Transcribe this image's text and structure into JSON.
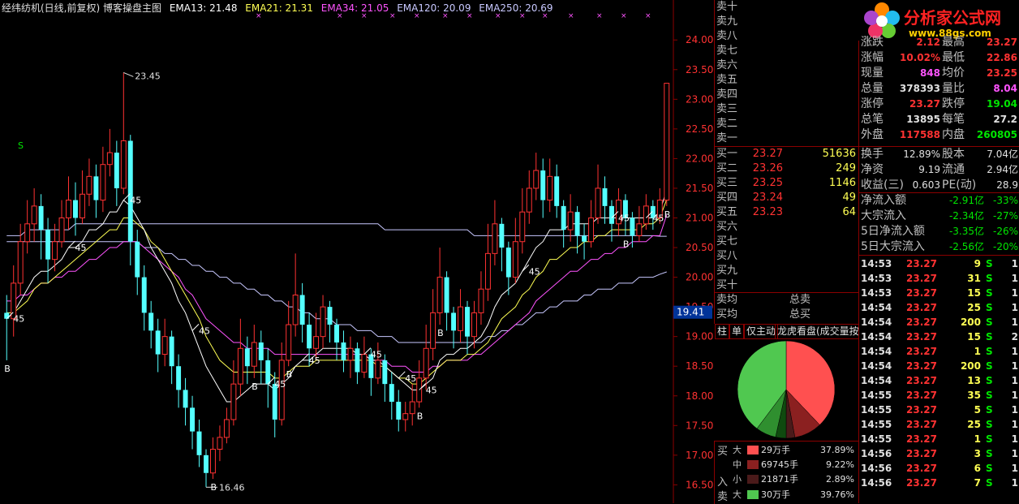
{
  "header": {
    "title": "经纬纺机(日线,前复权) 博客操盘主图",
    "ema13": "EMA13: 21.48",
    "ema21": "EMA21: 21.31",
    "ema34": "EMA34: 21.05",
    "ema120": "EMA120: 20.09",
    "ema250": "EMA250: 20.69"
  },
  "colors": {
    "up": "#ff3232",
    "down": "#54ffff",
    "ema13": "#ffffff",
    "ema21": "#ffff54",
    "ema34": "#ff54ff",
    "ema120": "#c8c8ff",
    "ema250": "#c8c8ff"
  },
  "price_axis": [
    "24.00",
    "23.50",
    "23.00",
    "22.50",
    "22.00",
    "21.50",
    "21.00",
    "20.50",
    "20.00",
    "19.50",
    "19.00",
    "18.50",
    "18.00",
    "17.50",
    "17.00",
    "16.50"
  ],
  "price_axis_current": "19.41",
  "annotations": {
    "high": "23.45",
    "low": "16.46",
    "mark45": "45",
    "b": "B",
    "s": "S"
  },
  "chart_data": {
    "type": "candlestick",
    "ylim": [
      16.3,
      24.4
    ],
    "candles": [
      [
        19.4,
        19.3,
        19.7,
        18.6
      ],
      [
        19.3,
        19.9,
        20.2,
        19.0
      ],
      [
        19.9,
        20.6,
        20.9,
        19.7
      ],
      [
        20.6,
        20.9,
        21.3,
        20.4
      ],
      [
        20.9,
        21.2,
        21.5,
        20.6
      ],
      [
        21.2,
        20.8,
        21.4,
        20.3
      ],
      [
        20.8,
        20.3,
        21.0,
        19.9
      ],
      [
        20.3,
        20.6,
        20.9,
        20.1
      ],
      [
        20.6,
        21.0,
        21.3,
        20.5
      ],
      [
        21.0,
        21.3,
        21.7,
        20.8
      ],
      [
        21.3,
        21.0,
        21.6,
        20.7
      ],
      [
        21.0,
        21.4,
        21.8,
        20.9
      ],
      [
        21.4,
        21.7,
        22.0,
        21.2
      ],
      [
        21.7,
        21.3,
        21.9,
        21.0
      ],
      [
        21.3,
        21.9,
        22.2,
        21.1
      ],
      [
        21.9,
        22.1,
        22.5,
        21.7
      ],
      [
        22.1,
        21.5,
        22.3,
        21.2
      ],
      [
        21.5,
        22.3,
        23.45,
        21.4
      ],
      [
        22.3,
        20.6,
        22.4,
        20.2
      ],
      [
        20.6,
        20.0,
        20.8,
        19.7
      ],
      [
        20.0,
        19.4,
        20.2,
        19.1
      ],
      [
        19.4,
        19.1,
        19.6,
        18.8
      ],
      [
        19.1,
        18.7,
        19.3,
        18.4
      ],
      [
        18.7,
        19.0,
        19.3,
        18.5
      ],
      [
        19.0,
        18.5,
        19.1,
        18.2
      ],
      [
        18.5,
        18.1,
        18.7,
        17.8
      ],
      [
        18.1,
        17.8,
        18.3,
        17.5
      ],
      [
        17.8,
        17.4,
        18.0,
        17.1
      ],
      [
        17.4,
        17.0,
        17.6,
        16.8
      ],
      [
        17.0,
        16.7,
        17.1,
        16.46
      ],
      [
        16.7,
        17.1,
        17.3,
        16.6
      ],
      [
        17.1,
        17.3,
        17.5,
        16.9
      ],
      [
        17.3,
        17.6,
        17.8,
        17.2
      ],
      [
        17.6,
        18.2,
        18.6,
        17.5
      ],
      [
        18.2,
        18.8,
        19.3,
        18.0
      ],
      [
        18.8,
        18.5,
        19.0,
        18.2
      ],
      [
        18.5,
        18.9,
        19.2,
        18.3
      ],
      [
        18.9,
        18.6,
        19.1,
        18.2
      ],
      [
        18.6,
        18.2,
        18.8,
        17.8
      ],
      [
        18.2,
        17.6,
        18.4,
        17.3
      ],
      [
        17.6,
        18.6,
        18.9,
        17.5
      ],
      [
        18.6,
        19.2,
        19.6,
        18.5
      ],
      [
        19.2,
        19.7,
        20.4,
        19.0
      ],
      [
        19.7,
        19.2,
        19.9,
        18.9
      ],
      [
        19.2,
        18.8,
        19.4,
        18.5
      ],
      [
        18.8,
        19.0,
        19.4,
        18.6
      ],
      [
        19.0,
        19.5,
        19.7,
        18.8
      ],
      [
        19.5,
        19.2,
        19.6,
        18.9
      ],
      [
        19.2,
        18.9,
        19.3,
        18.6
      ],
      [
        18.9,
        18.6,
        19.1,
        18.4
      ],
      [
        18.6,
        18.8,
        19.0,
        18.3
      ],
      [
        18.8,
        18.4,
        18.9,
        18.2
      ],
      [
        18.4,
        18.7,
        19.0,
        18.3
      ],
      [
        18.7,
        18.3,
        18.8,
        18.0
      ],
      [
        18.3,
        18.6,
        18.9,
        18.2
      ],
      [
        18.6,
        18.2,
        18.7,
        17.9
      ],
      [
        18.2,
        17.9,
        18.4,
        17.6
      ],
      [
        17.9,
        17.6,
        18.1,
        17.4
      ],
      [
        17.6,
        17.7,
        17.9,
        17.4
      ],
      [
        17.7,
        17.9,
        18.2,
        17.5
      ],
      [
        17.9,
        18.3,
        18.6,
        17.8
      ],
      [
        18.3,
        18.8,
        19.2,
        18.1
      ],
      [
        18.8,
        19.4,
        19.8,
        18.6
      ],
      [
        19.4,
        20.0,
        20.5,
        19.2
      ],
      [
        20.0,
        19.4,
        20.1,
        19.1
      ],
      [
        19.4,
        19.1,
        19.5,
        18.8
      ],
      [
        19.1,
        19.5,
        19.8,
        18.9
      ],
      [
        19.5,
        19.0,
        19.6,
        18.7
      ],
      [
        19.0,
        19.4,
        19.6,
        18.8
      ],
      [
        19.4,
        19.8,
        20.1,
        19.2
      ],
      [
        19.8,
        20.4,
        20.9,
        19.6
      ],
      [
        20.4,
        20.9,
        21.3,
        20.2
      ],
      [
        20.9,
        20.5,
        21.0,
        20.1
      ],
      [
        20.5,
        20.0,
        20.6,
        19.7
      ],
      [
        20.0,
        20.6,
        21.0,
        19.9
      ],
      [
        20.6,
        21.1,
        21.5,
        20.4
      ],
      [
        21.1,
        21.5,
        21.8,
        20.9
      ],
      [
        21.5,
        21.8,
        22.1,
        21.3
      ],
      [
        21.8,
        21.3,
        22.0,
        21.0
      ],
      [
        21.3,
        21.7,
        22.0,
        21.1
      ],
      [
        21.7,
        21.2,
        21.9,
        21.0
      ],
      [
        21.2,
        20.8,
        21.3,
        20.5
      ],
      [
        20.8,
        21.1,
        21.4,
        20.6
      ],
      [
        21.1,
        20.7,
        21.2,
        20.4
      ],
      [
        20.7,
        20.6,
        20.9,
        20.3
      ],
      [
        20.6,
        21.0,
        21.3,
        20.5
      ],
      [
        21.0,
        21.5,
        21.9,
        20.9
      ],
      [
        21.5,
        21.2,
        21.7,
        20.9
      ],
      [
        21.2,
        20.9,
        21.3,
        20.6
      ],
      [
        20.9,
        21.3,
        21.5,
        20.7
      ],
      [
        21.3,
        21.0,
        21.4,
        20.7
      ],
      [
        21.0,
        20.7,
        21.1,
        20.5
      ],
      [
        20.7,
        20.9,
        21.2,
        20.6
      ],
      [
        20.9,
        21.2,
        21.4,
        20.8
      ],
      [
        21.2,
        21.0,
        21.3,
        20.8
      ],
      [
        21.0,
        21.3,
        21.5,
        20.9
      ],
      [
        21.3,
        23.27,
        23.27,
        21.2
      ]
    ],
    "ema13": [
      19.3,
      19.4,
      19.6,
      19.8,
      20.0,
      20.1,
      20.1,
      20.2,
      20.3,
      20.5,
      20.5,
      20.6,
      20.8,
      20.8,
      20.9,
      21.1,
      21.1,
      21.3,
      21.2,
      21.0,
      20.8,
      20.5,
      20.3,
      20.1,
      19.9,
      19.6,
      19.4,
      19.1,
      18.8,
      18.5,
      18.3,
      18.1,
      17.9,
      17.9,
      18.0,
      18.1,
      18.2,
      18.2,
      18.2,
      18.1,
      18.2,
      18.3,
      18.5,
      18.6,
      18.6,
      18.7,
      18.8,
      18.8,
      18.8,
      18.8,
      18.8,
      18.7,
      18.7,
      18.6,
      18.6,
      18.5,
      18.4,
      18.3,
      18.2,
      18.1,
      18.1,
      18.2,
      18.3,
      18.6,
      18.7,
      18.7,
      18.8,
      18.8,
      18.9,
      19.0,
      19.2,
      19.5,
      19.7,
      19.8,
      19.9,
      20.1,
      20.3,
      20.5,
      20.6,
      20.8,
      20.8,
      20.8,
      20.9,
      20.9,
      20.9,
      20.9,
      21.0,
      21.0,
      21.0,
      21.0,
      21.0,
      21.0,
      21.0,
      21.0,
      21.0,
      21.1,
      21.48
    ],
    "ema21": [
      19.4,
      19.4,
      19.5,
      19.6,
      19.8,
      19.9,
      19.9,
      20.0,
      20.1,
      20.2,
      20.3,
      20.4,
      20.5,
      20.6,
      20.7,
      20.8,
      20.8,
      21.0,
      21.0,
      20.9,
      20.8,
      20.6,
      20.5,
      20.3,
      20.1,
      19.9,
      19.7,
      19.5,
      19.3,
      19.0,
      18.8,
      18.6,
      18.5,
      18.4,
      18.4,
      18.4,
      18.4,
      18.4,
      18.4,
      18.3,
      18.3,
      18.4,
      18.5,
      18.5,
      18.5,
      18.6,
      18.6,
      18.6,
      18.6,
      18.6,
      18.6,
      18.6,
      18.6,
      18.6,
      18.5,
      18.5,
      18.4,
      18.3,
      18.3,
      18.2,
      18.2,
      18.3,
      18.4,
      18.5,
      18.6,
      18.6,
      18.6,
      18.7,
      18.7,
      18.8,
      18.9,
      19.1,
      19.3,
      19.4,
      19.5,
      19.7,
      19.8,
      20.0,
      20.1,
      20.3,
      20.3,
      20.4,
      20.5,
      20.5,
      20.6,
      20.6,
      20.7,
      20.7,
      20.8,
      20.8,
      20.8,
      20.8,
      20.8,
      20.9,
      20.9,
      21.0,
      21.31
    ],
    "ema34": [
      19.6,
      19.6,
      19.7,
      19.7,
      19.8,
      19.9,
      19.9,
      20.0,
      20.0,
      20.1,
      20.1,
      20.2,
      20.3,
      20.3,
      20.4,
      20.5,
      20.5,
      20.6,
      20.6,
      20.6,
      20.5,
      20.4,
      20.3,
      20.2,
      20.1,
      20.0,
      19.8,
      19.7,
      19.5,
      19.3,
      19.2,
      19.1,
      19.0,
      18.9,
      18.9,
      18.8,
      18.8,
      18.8,
      18.8,
      18.7,
      18.7,
      18.7,
      18.7,
      18.7,
      18.7,
      18.7,
      18.7,
      18.7,
      18.7,
      18.7,
      18.7,
      18.7,
      18.7,
      18.6,
      18.6,
      18.6,
      18.5,
      18.5,
      18.5,
      18.4,
      18.4,
      18.4,
      18.5,
      18.5,
      18.6,
      18.6,
      18.6,
      18.6,
      18.7,
      18.7,
      18.8,
      18.9,
      19.0,
      19.1,
      19.2,
      19.3,
      19.4,
      19.6,
      19.7,
      19.8,
      19.9,
      20.0,
      20.1,
      20.1,
      20.2,
      20.3,
      20.3,
      20.4,
      20.4,
      20.5,
      20.5,
      20.6,
      20.6,
      20.6,
      20.7,
      20.7,
      21.05
    ],
    "ema120": [
      20.6,
      20.6,
      20.6,
      20.6,
      20.6,
      20.6,
      20.6,
      20.6,
      20.6,
      20.6,
      20.6,
      20.6,
      20.6,
      20.6,
      20.6,
      20.6,
      20.6,
      20.6,
      20.6,
      20.6,
      20.5,
      20.5,
      20.5,
      20.4,
      20.4,
      20.3,
      20.3,
      20.2,
      20.2,
      20.1,
      20.1,
      20.0,
      20.0,
      19.9,
      19.9,
      19.8,
      19.8,
      19.7,
      19.7,
      19.6,
      19.6,
      19.5,
      19.5,
      19.4,
      19.4,
      19.3,
      19.3,
      19.3,
      19.2,
      19.2,
      19.2,
      19.1,
      19.1,
      19.1,
      19.0,
      19.0,
      19.0,
      18.9,
      18.9,
      18.9,
      18.9,
      18.9,
      18.9,
      18.9,
      18.9,
      18.9,
      18.9,
      18.9,
      18.9,
      18.9,
      19.0,
      19.0,
      19.1,
      19.1,
      19.2,
      19.2,
      19.3,
      19.4,
      19.4,
      19.5,
      19.5,
      19.6,
      19.6,
      19.6,
      19.7,
      19.7,
      19.8,
      19.8,
      19.8,
      19.9,
      19.9,
      19.9,
      20.0,
      20.0,
      20.0,
      20.05,
      20.09
    ],
    "ema250": [
      20.7,
      20.7,
      20.7,
      20.8,
      20.8,
      20.8,
      20.8,
      20.8,
      20.8,
      20.8,
      20.9,
      20.9,
      20.9,
      20.9,
      20.9,
      20.9,
      20.9,
      20.9,
      20.9,
      20.9,
      20.9,
      20.9,
      20.9,
      20.9,
      20.9,
      20.9,
      20.9,
      20.9,
      20.9,
      20.9,
      20.9,
      20.9,
      20.9,
      20.9,
      20.9,
      20.9,
      20.9,
      20.9,
      20.9,
      20.9,
      20.9,
      20.9,
      20.9,
      20.9,
      20.9,
      20.9,
      20.9,
      20.9,
      20.9,
      20.9,
      20.9,
      20.9,
      20.9,
      20.9,
      20.9,
      20.8,
      20.8,
      20.8,
      20.8,
      20.8,
      20.8,
      20.8,
      20.8,
      20.8,
      20.8,
      20.8,
      20.8,
      20.8,
      20.7,
      20.7,
      20.7,
      20.7,
      20.7,
      20.7,
      20.7,
      20.7,
      20.7,
      20.7,
      20.7,
      20.7,
      20.7,
      20.7,
      20.7,
      20.7,
      20.7,
      20.7,
      20.7,
      20.7,
      20.7,
      20.7,
      20.7,
      20.7,
      20.7,
      20.7,
      20.7,
      20.69,
      20.69
    ]
  },
  "order_book": {
    "sell": [
      {
        "label": "卖十"
      },
      {
        "label": "卖九"
      },
      {
        "label": "卖八"
      },
      {
        "label": "卖七"
      },
      {
        "label": "卖六"
      },
      {
        "label": "卖五"
      },
      {
        "label": "卖四"
      },
      {
        "label": "卖三"
      },
      {
        "label": "卖二"
      },
      {
        "label": "卖一"
      }
    ],
    "buy": [
      {
        "label": "买一",
        "price": "23.27",
        "vol": "51636"
      },
      {
        "label": "买二",
        "price": "23.26",
        "vol": "249"
      },
      {
        "label": "买三",
        "price": "23.25",
        "vol": "1146"
      },
      {
        "label": "买四",
        "price": "23.24",
        "vol": "49"
      },
      {
        "label": "买五",
        "price": "23.23",
        "vol": "64"
      },
      {
        "label": "买六"
      },
      {
        "label": "买七"
      },
      {
        "label": "买八"
      },
      {
        "label": "买九"
      },
      {
        "label": "买十"
      }
    ],
    "sell_avg_label": "卖均",
    "total_sell_label": "总卖",
    "buy_avg_label": "买均",
    "total_buy_label": "总买"
  },
  "tabs": [
    "柱",
    "单",
    "仅主动",
    "龙虎看盘(成交量按"
  ],
  "pie": {
    "slices": [
      {
        "name": "买大",
        "pct": 37.89,
        "color": "#ff5050"
      },
      {
        "name": "买中",
        "pct": 9.22,
        "color": "#8b2020"
      },
      {
        "name": "买小",
        "pct": 2.89,
        "color": "#4a1a1a"
      },
      {
        "name": "卖小",
        "pct": 3.5,
        "color": "#0f4a0f"
      },
      {
        "name": "卖中",
        "pct": 6.74,
        "color": "#2f8f2f"
      },
      {
        "name": "卖大",
        "pct": 39.76,
        "color": "#50c850"
      }
    ]
  },
  "flow_table": {
    "buy_label": "买",
    "in_label": "入",
    "sell_label": "卖",
    "rows": [
      {
        "size": "大",
        "color": "#ff5050",
        "vol": "29万手",
        "pct": "37.89%"
      },
      {
        "size": "中",
        "color": "#8b2020",
        "vol": "69745手",
        "pct": "9.22%"
      },
      {
        "size": "小",
        "color": "#4a1a1a",
        "vol": "21871手",
        "pct": "2.89%"
      },
      {
        "size": "大",
        "color": "#50c850",
        "vol": "30万手",
        "pct": "39.76%"
      }
    ]
  },
  "logo": {
    "text1": "分析家公式网",
    "text2": "www.88gs.com"
  },
  "quote": [
    {
      "l1": "涨跌",
      "v1": "2.12",
      "l2": "最高",
      "v2": "23.27"
    },
    {
      "l1": "涨幅",
      "v1": "10.02%",
      "l2": "最低",
      "v2": "22.86"
    },
    {
      "l1": "现量",
      "v1": "848",
      "l2": "均价",
      "v2": "23.25"
    },
    {
      "l1": "总量",
      "v1": "378393",
      "l2": "量比",
      "v2": "8.04"
    },
    {
      "l1": "涨停",
      "v1": "23.27",
      "l2": "跌停",
      "v2": "19.04"
    },
    {
      "l1": "总笔",
      "v1": "13895",
      "l2": "每笔",
      "v2": "27.2"
    },
    {
      "l1": "外盘",
      "v1": "117588",
      "l2": "内盘",
      "v2": "260805"
    }
  ],
  "fund": [
    {
      "l1": "换手",
      "v1": "12.89%",
      "l2": "股本",
      "v2": "7.04亿"
    },
    {
      "l1": "净资",
      "v1": "9.19",
      "l2": "流通",
      "v2": "2.94亿"
    },
    {
      "l1": "收益(三)",
      "v1": "0.603",
      "l2": "PE(动)",
      "v2": "28.9"
    }
  ],
  "flows": [
    {
      "l": "净流入额",
      "v": "-2.91亿",
      "p": "-33%"
    },
    {
      "l": "大宗流入",
      "v": "-2.34亿",
      "p": "-27%"
    },
    {
      "l": "5日净流入额",
      "v": "-3.35亿",
      "p": "-26%"
    },
    {
      "l": "5日大宗流入",
      "v": "-2.56亿",
      "p": "-20%"
    }
  ],
  "ticks": [
    {
      "t": "14:53",
      "p": "23.27",
      "v": "9",
      "s": "S",
      "n": "1"
    },
    {
      "t": "14:53",
      "p": "23.27",
      "v": "31",
      "s": "S",
      "n": "1"
    },
    {
      "t": "14:53",
      "p": "23.27",
      "v": "15",
      "s": "S",
      "n": "1"
    },
    {
      "t": "14:54",
      "p": "23.27",
      "v": "25",
      "s": "S",
      "n": "1"
    },
    {
      "t": "14:54",
      "p": "23.27",
      "v": "200",
      "s": "S",
      "n": "1"
    },
    {
      "t": "14:54",
      "p": "23.27",
      "v": "15",
      "s": "S",
      "n": "2"
    },
    {
      "t": "14:54",
      "p": "23.27",
      "v": "1",
      "s": "S",
      "n": "1"
    },
    {
      "t": "14:54",
      "p": "23.27",
      "v": "200",
      "s": "S",
      "n": "1"
    },
    {
      "t": "14:54",
      "p": "23.27",
      "v": "13",
      "s": "S",
      "n": "1"
    },
    {
      "t": "14:55",
      "p": "23.27",
      "v": "35",
      "s": "S",
      "n": "1"
    },
    {
      "t": "14:55",
      "p": "23.27",
      "v": "5",
      "s": "S",
      "n": "1"
    },
    {
      "t": "14:55",
      "p": "23.27",
      "v": "25",
      "s": "S",
      "n": "1"
    },
    {
      "t": "14:55",
      "p": "23.27",
      "v": "1",
      "s": "S",
      "n": "1"
    },
    {
      "t": "14:56",
      "p": "23.27",
      "v": "3",
      "s": "S",
      "n": "1"
    },
    {
      "t": "14:56",
      "p": "23.27",
      "v": "6",
      "s": "S",
      "n": "1"
    },
    {
      "t": "14:56",
      "p": "23.27",
      "v": "7",
      "s": "S",
      "n": "1"
    }
  ]
}
